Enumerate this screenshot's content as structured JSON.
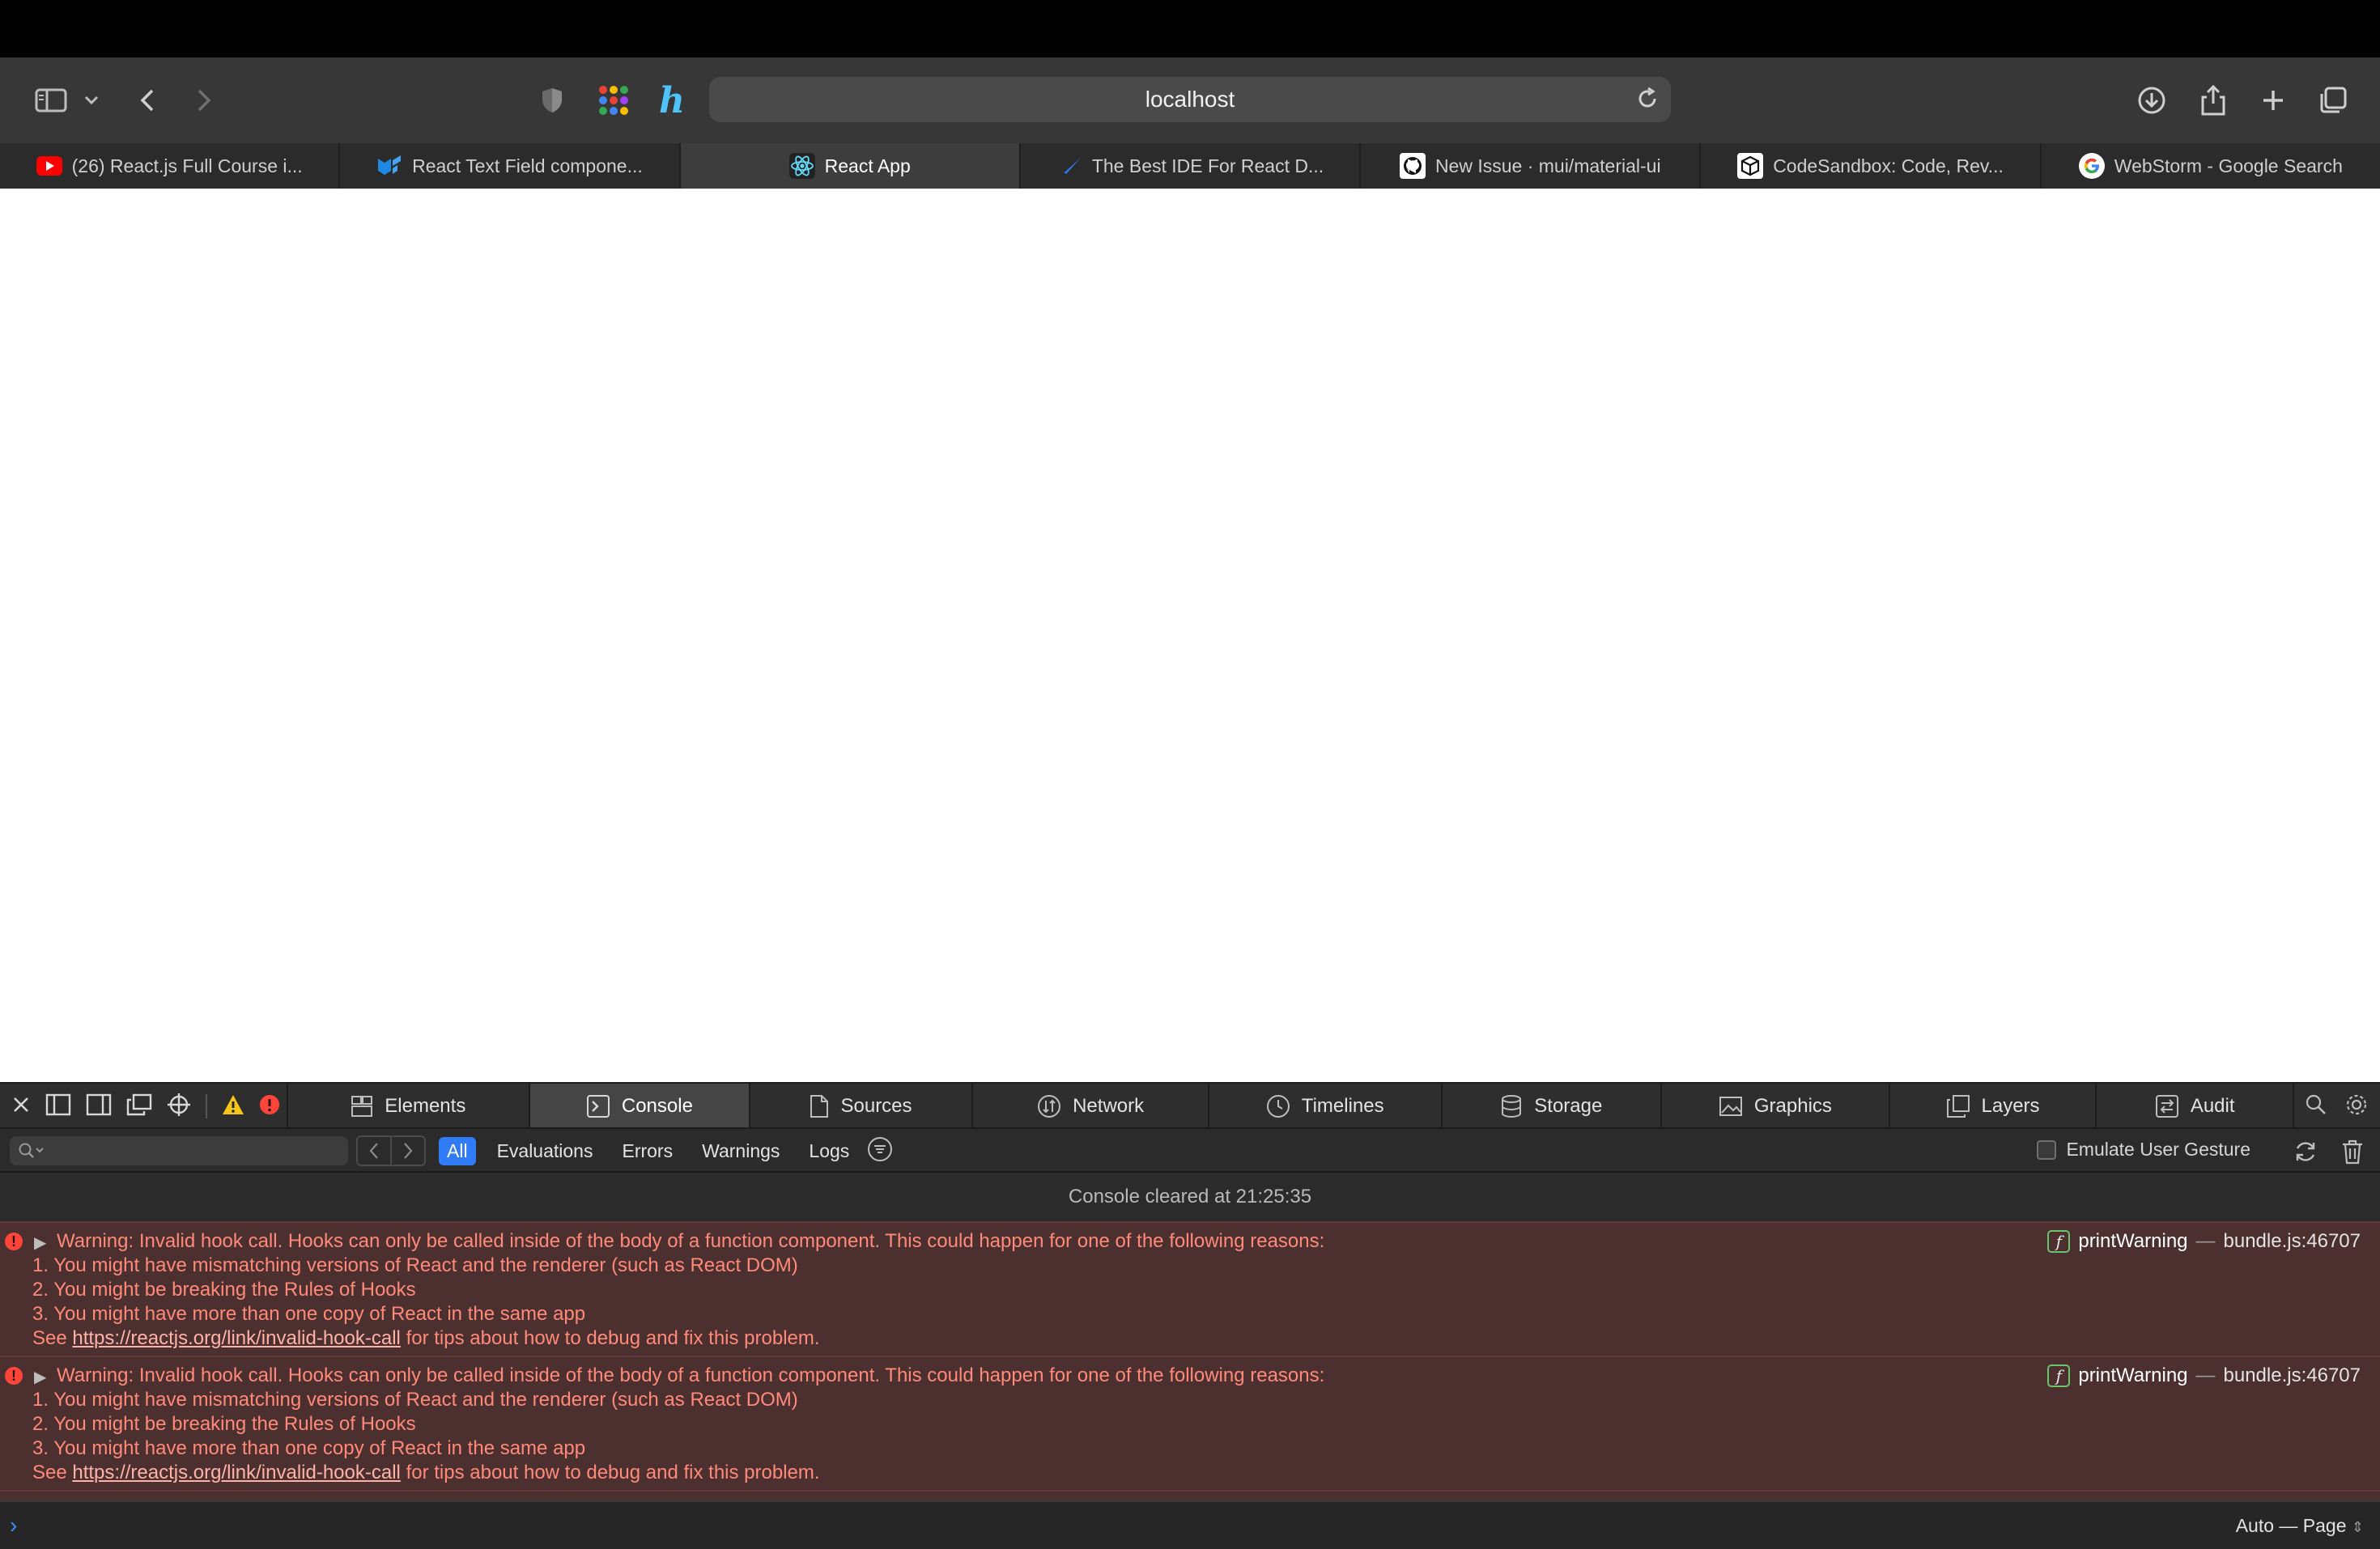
{
  "toolbar": {
    "address": "localhost"
  },
  "tabs": [
    {
      "label": "(26) React.js Full Course i...",
      "icon": "youtube-icon",
      "color": "#ff0000"
    },
    {
      "label": "React Text Field compone...",
      "icon": "mui-icon",
      "color": "#1e88e5"
    },
    {
      "label": "React App",
      "icon": "react-icon",
      "color": "#61dafb",
      "active": true
    },
    {
      "label": "The Best IDE For React D...",
      "icon": "check-icon",
      "color": "#2f7cf6"
    },
    {
      "label": "New Issue · mui/material-ui",
      "icon": "github-icon",
      "color": "#ffffff"
    },
    {
      "label": "CodeSandbox: Code, Rev...",
      "icon": "codesandbox-icon",
      "color": "#ffffff"
    },
    {
      "label": "WebStorm - Google Search",
      "icon": "google-icon",
      "color": "#4285f4"
    }
  ],
  "devtools": {
    "tabs": [
      "Elements",
      "Console",
      "Sources",
      "Network",
      "Timelines",
      "Storage",
      "Graphics",
      "Layers",
      "Audit"
    ],
    "active_tab": "Console",
    "filters": [
      "All",
      "Evaluations",
      "Errors",
      "Warnings",
      "Logs"
    ],
    "active_filter": "All",
    "emulate_label": "Emulate User Gesture",
    "cleared_text": "Console cleared at 21:25:35",
    "messages": [
      {
        "line1": "Warning: Invalid hook call. Hooks can only be called inside of the body of a function component. This could happen for one of the following reasons:",
        "line2": "1. You might have mismatching versions of React and the renderer (such as React DOM)",
        "line3": "2. You might be breaking the Rules of Hooks",
        "line4": "3. You might have more than one copy of React in the same app",
        "see": "See",
        "link": "https://reactjs.org/link/invalid-hook-call",
        "tail": "for tips about how to debug and fix this problem.",
        "fn": "printWarning",
        "dash": "—",
        "file": "bundle.js:46707"
      },
      {
        "line1": "Warning: Invalid hook call. Hooks can only be called inside of the body of a function component. This could happen for one of the following reasons:",
        "line2": "1. You might have mismatching versions of React and the renderer (such as React DOM)",
        "line3": "2. You might be breaking the Rules of Hooks",
        "line4": "3. You might have more than one copy of React in the same app",
        "see": "See",
        "link": "https://reactjs.org/link/invalid-hook-call",
        "tail": "for tips about how to debug and fix this problem.",
        "fn": "printWarning",
        "dash": "—",
        "file": "bundle.js:46707"
      }
    ],
    "context_selector": "Auto — Page"
  },
  "colors": {
    "accent": "#2f7cf6",
    "error_bg": "#4c2f2f",
    "error_text": "#ff8a7a"
  }
}
